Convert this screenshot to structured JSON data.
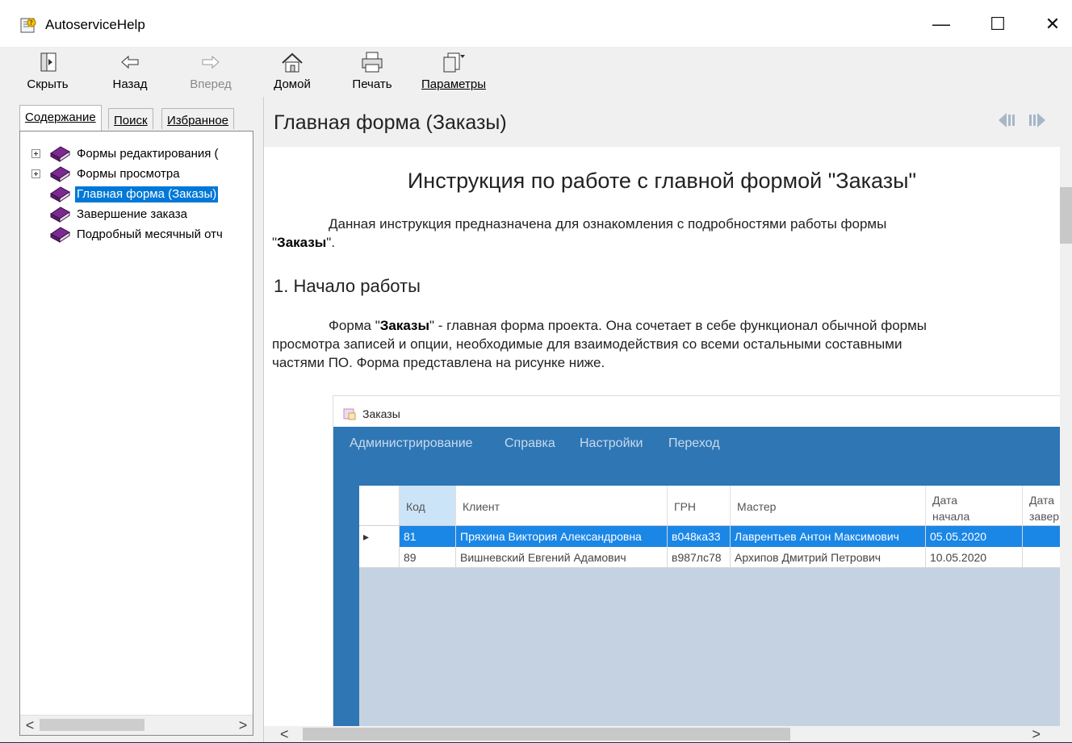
{
  "window": {
    "title": "AutoserviceHelp"
  },
  "window_controls": {
    "minimize": "—",
    "maximize": "☐",
    "close": "✕"
  },
  "toolbar": {
    "hide": "Скрыть",
    "back": "Назад",
    "forward": "Вперед",
    "home": "Домой",
    "print": "Печать",
    "options": "Параметры"
  },
  "left_panel": {
    "tabs": [
      "Содержание",
      "Поиск",
      "Избранное"
    ],
    "tree": [
      {
        "label": "Формы редактирования (",
        "expandable": true
      },
      {
        "label": "Формы просмотра",
        "expandable": true
      },
      {
        "label": "Главная форма (Заказы)",
        "selected": true
      },
      {
        "label": "Завершение заказа"
      },
      {
        "label": "Подробный месячный отч"
      }
    ]
  },
  "topic": {
    "title": "Главная форма (Заказы)",
    "heading": "Инструкция по работе с главной формой \"Заказы\"",
    "intro_a": "Данная инструкция предназначена для ознакомления с подробностями работы формы",
    "intro_b": "\"Заказы\".",
    "intro_bold": "Заказы",
    "section1": "1. Начало работы",
    "p1_a": "Форма \"",
    "p1_bold": "Заказы",
    "p1_b": "\" - главная форма проекта. Она сочетает в себе функционал обычной формы",
    "p1_c": "просмотра записей и опции, необходимые для взаимодействия со всеми остальными составными",
    "p1_d": "частями ПО. Форма представлена на рисунке ниже."
  },
  "screenshot": {
    "window_title": "Заказы",
    "menu": [
      "Администрирование",
      "Справка",
      "Настройки",
      "Переход"
    ],
    "columns": [
      "Код",
      "Клиент",
      "ГРН",
      "Мастер",
      "Дата\nначала",
      "Дата\nзавер"
    ],
    "rows": [
      [
        "81",
        "Пряхина Виктория Александровна",
        "в048ка33",
        "Лаврентьев Антон Максимович",
        "05.05.2020",
        ""
      ],
      [
        "89",
        "Вишневский Евгений Адамович",
        "в987лс78",
        "Архипов Дмитрий Петрович",
        "10.05.2020",
        ""
      ]
    ]
  },
  "scroll": {
    "left": "<",
    "right": ">",
    "up": "^",
    "down": "v"
  }
}
